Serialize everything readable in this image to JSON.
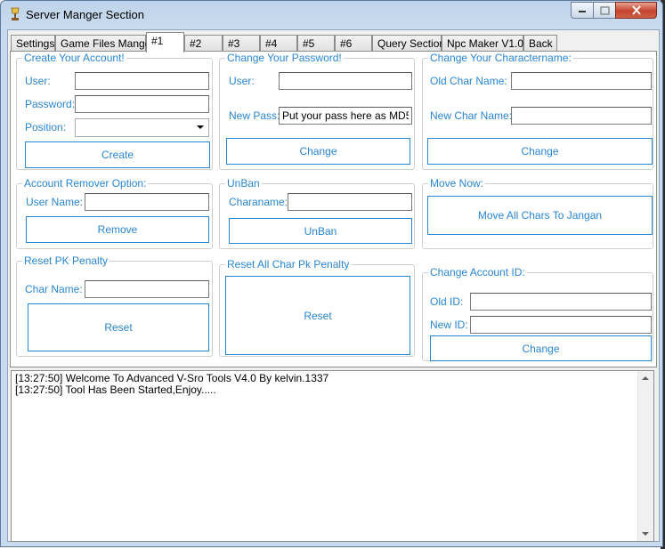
{
  "window": {
    "title": "Server Manger Section"
  },
  "tabs": [
    {
      "label": "Settings"
    },
    {
      "label": "Game Files Manger"
    },
    {
      "label": "#1"
    },
    {
      "label": "#2"
    },
    {
      "label": "#3"
    },
    {
      "label": "#4"
    },
    {
      "label": "#5"
    },
    {
      "label": "#6"
    },
    {
      "label": "Query Section"
    },
    {
      "label": "Npc Maker V1.0"
    },
    {
      "label": "Back"
    }
  ],
  "active_tab": "#1",
  "create_account": {
    "legend": "Create Your Account!",
    "user_label": "User:",
    "user_value": "",
    "password_label": "Password:",
    "password_value": "",
    "position_label": "Position:",
    "position_value": "",
    "create_button": "Create"
  },
  "change_password": {
    "legend": "Change Your Password!",
    "user_label": "User:",
    "user_value": "",
    "new_pass_label": "New Pass:",
    "new_pass_value": "Put your pass here as MD5",
    "change_button": "Change"
  },
  "change_charname": {
    "legend": "Change Your Charactername:",
    "old_label": "Old Char Name:",
    "old_value": "",
    "new_label": "New Char Name:",
    "new_value": "",
    "change_button": "Change"
  },
  "account_remover": {
    "legend": "Account Remover Option:",
    "user_label": "User Name:",
    "user_value": "",
    "remove_button": "Remove"
  },
  "unban": {
    "legend": "UnBan",
    "charname_label": "Charaname:",
    "charname_value": "",
    "unban_button": "UnBan"
  },
  "move_now": {
    "legend": "Move Now:",
    "move_button": "Move All Chars To Jangan"
  },
  "reset_pk": {
    "legend": "Reset PK Penalty",
    "char_label": "Char Name:",
    "char_value": "",
    "reset_button": "Reset"
  },
  "reset_all_pk": {
    "legend": "Reset All Char Pk Penalty",
    "reset_button": "Reset"
  },
  "change_account_id": {
    "legend": "Change Account ID:",
    "old_label": "Old ID:",
    "old_value": "",
    "new_label": "New ID:",
    "new_value": "",
    "change_button": "Change"
  },
  "log": {
    "lines": [
      "[13:27:50] Welcome To Advanced V-Sro Tools V4.0 By kelvin.1337",
      "[13:27:50] Tool Has Been Started,Enjoy....."
    ]
  },
  "colors": {
    "accent": "#2a85d0",
    "close_button": "#c5422b"
  },
  "icons": {
    "app": "lamp-icon",
    "minimize": "minimize-icon",
    "maximize": "maximize-icon",
    "close": "close-icon"
  }
}
